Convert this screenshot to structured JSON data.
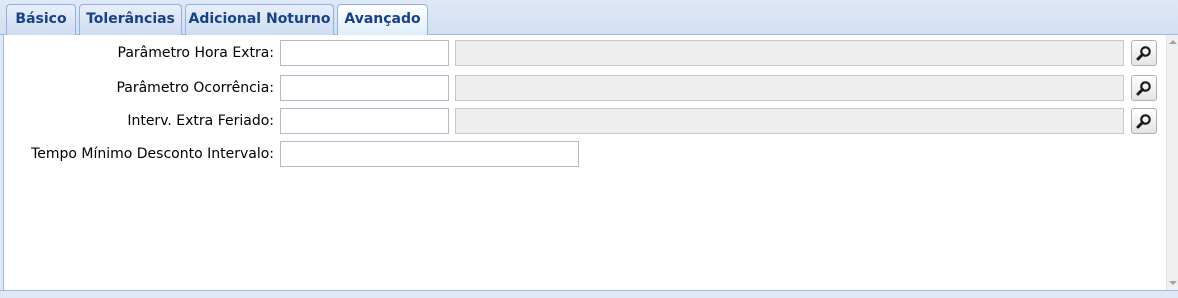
{
  "tabs": [
    {
      "label": "Básico",
      "active": false
    },
    {
      "label": "Tolerâncias",
      "active": false
    },
    {
      "label": "Adicional Noturno",
      "active": false
    },
    {
      "label": "Avançado",
      "active": true
    }
  ],
  "form": {
    "hora_extra": {
      "label": "Parâmetro Hora Extra:",
      "code_value": "",
      "description_value": ""
    },
    "ocorrencia": {
      "label": "Parâmetro Ocorrência:",
      "code_value": "",
      "description_value": ""
    },
    "extra_feriado": {
      "label": "Interv. Extra Feriado:",
      "code_value": "",
      "description_value": ""
    },
    "tempo_minimo": {
      "label": "Tempo Mínimo Desconto Intervalo:",
      "value": ""
    }
  },
  "icons": {
    "search": "magnifier-icon"
  },
  "colors": {
    "tab_text": "#15428b",
    "tab_border": "#8db2e3",
    "panel_background": "#dfe8f6",
    "readonly_field": "#eeeeee"
  }
}
